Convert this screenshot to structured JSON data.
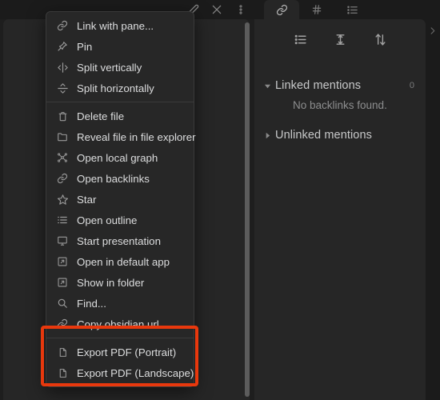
{
  "window": {
    "app": "obsidian",
    "theme": "dark",
    "background_color": "#1e1e1e",
    "panel_color": "#262626",
    "text_color": "#dcddde",
    "accent_highlight_color": "#e8380d"
  },
  "editor_pane": {
    "actions": [
      {
        "name": "edit-pencil-icon",
        "label": "Edit"
      },
      {
        "name": "close-icon",
        "label": "Close"
      },
      {
        "name": "more-options-icon",
        "label": "More options"
      }
    ],
    "scrollbar": {
      "name": "vertical-scrollbar"
    }
  },
  "context_menu": {
    "groups": [
      {
        "items": [
          {
            "icon": "link-icon",
            "label": "Link with pane..."
          },
          {
            "icon": "pin-icon",
            "label": "Pin"
          },
          {
            "icon": "split-vertical-icon",
            "label": "Split vertically"
          },
          {
            "icon": "split-horizontal-icon",
            "label": "Split horizontally"
          }
        ]
      },
      {
        "items": [
          {
            "icon": "trash-icon",
            "label": "Delete file"
          },
          {
            "icon": "folder-icon",
            "label": "Reveal file in file explorer"
          },
          {
            "icon": "graph-icon",
            "label": "Open local graph"
          },
          {
            "icon": "link-icon",
            "label": "Open backlinks"
          },
          {
            "icon": "star-icon",
            "label": "Star"
          },
          {
            "icon": "outline-icon",
            "label": "Open outline"
          },
          {
            "icon": "presentation-icon",
            "label": "Start presentation"
          },
          {
            "icon": "external-app-icon",
            "label": "Open in default app"
          },
          {
            "icon": "external-app-icon",
            "label": "Show in folder"
          },
          {
            "icon": "search-icon",
            "label": "Find..."
          },
          {
            "icon": "link-icon",
            "label": "Copy obsidian url"
          }
        ]
      },
      {
        "highlighted": true,
        "items": [
          {
            "icon": "file-icon",
            "label": "Export PDF (Portrait)"
          },
          {
            "icon": "file-icon",
            "label": "Export PDF (Landscape)"
          }
        ]
      }
    ]
  },
  "right_sidebar": {
    "tabs": [
      {
        "icon": "link-icon",
        "name": "tab-backlinks",
        "active": true
      },
      {
        "icon": "hash-icon",
        "name": "tab-tags",
        "active": false
      },
      {
        "icon": "outline-icon",
        "name": "tab-outline",
        "active": false
      }
    ],
    "toolbar": [
      {
        "icon": "collapse-results-icon",
        "label": "Collapse results"
      },
      {
        "icon": "show-context-icon",
        "label": "Show more context"
      },
      {
        "icon": "sort-icon",
        "label": "Change sort order"
      }
    ],
    "sections": [
      {
        "title": "Linked mentions",
        "count": "0",
        "expanded": true,
        "empty_text": "No backlinks found."
      },
      {
        "title": "Unlinked mentions",
        "count": "",
        "expanded": false,
        "empty_text": ""
      }
    ],
    "collapse_button": {
      "icon": "chevron-right-icon",
      "label": "Collapse sidebar"
    }
  }
}
